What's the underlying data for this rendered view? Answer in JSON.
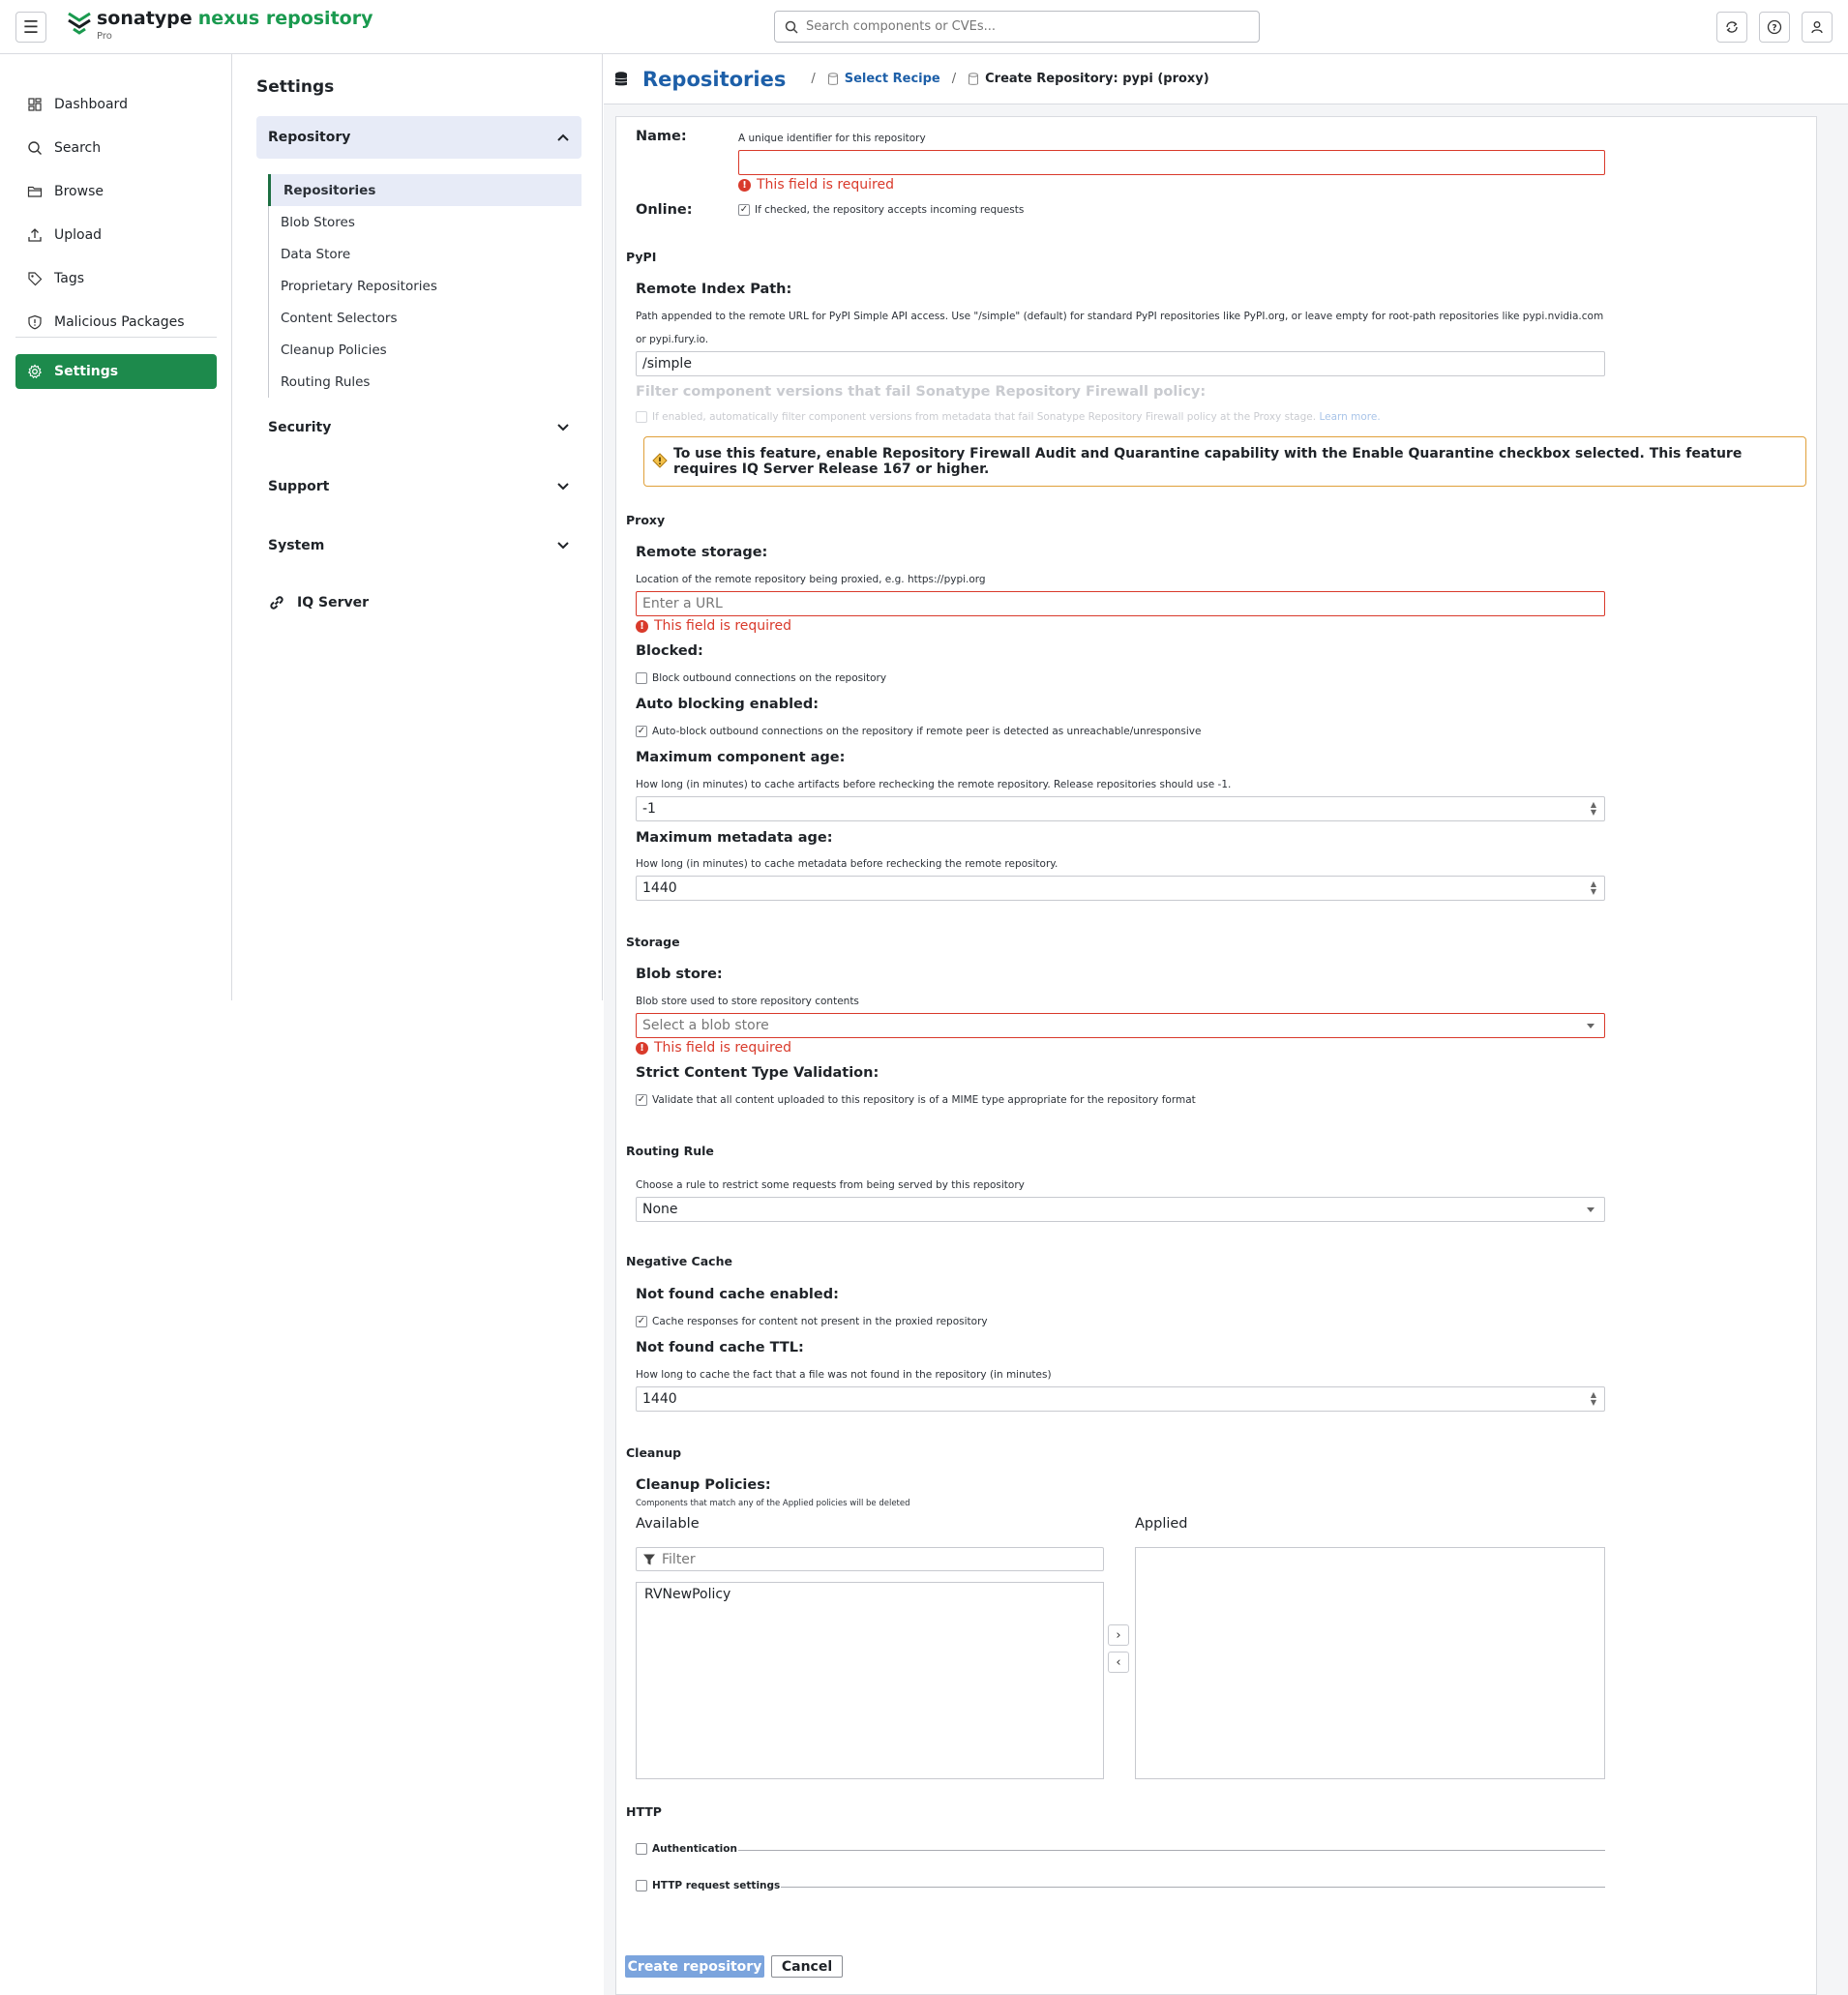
{
  "header": {
    "logo_brand": "sonatype",
    "logo_product": "nexus repository",
    "logo_edition": "Pro",
    "search_placeholder": "Search components or CVEs...",
    "icons": [
      "menu-icon",
      "refresh-icon",
      "help-icon",
      "user-icon"
    ]
  },
  "leftnav": {
    "items": [
      {
        "label": "Dashboard",
        "icon": "dashboard-icon"
      },
      {
        "label": "Search",
        "icon": "search-icon"
      },
      {
        "label": "Browse",
        "icon": "folder-icon"
      },
      {
        "label": "Upload",
        "icon": "upload-icon"
      },
      {
        "label": "Tags",
        "icon": "tag-icon"
      },
      {
        "label": "Malicious Packages",
        "icon": "shield-icon"
      }
    ],
    "settings_label": "Settings"
  },
  "settings": {
    "title": "Settings",
    "repository": "Repository",
    "repo_items": [
      "Repositories",
      "Blob Stores",
      "Data Store",
      "Proprietary Repositories",
      "Content Selectors",
      "Cleanup Policies",
      "Routing Rules"
    ],
    "security": "Security",
    "support": "Support",
    "system": "System",
    "iq_server": "IQ Server"
  },
  "breadcrumb": {
    "root": "Repositories",
    "sep1": "/",
    "select_recipe": "Select Recipe",
    "sep2": "/",
    "current": "Create Repository: pypi (proxy)"
  },
  "form": {
    "required_msg": "This field is required",
    "name": {
      "label": "Name:",
      "hint": "A unique identifier for this repository",
      "value": ""
    },
    "online": {
      "label": "Online:",
      "hint": "If checked, the repository accepts incoming requests",
      "checked": true
    },
    "pypi": {
      "section": "PyPI",
      "remote_index_label": "Remote Index Path:",
      "remote_index_hint1": "Path appended to the remote URL for PyPI Simple API access. Use \"/simple\" (default) for standard PyPI repositories like PyPI.org, or leave empty for root-path repositories like pypi.nvidia.com",
      "remote_index_hint2": "or pypi.fury.io.",
      "remote_index_value": "/simple",
      "firewall_label": "Filter component versions that fail Sonatype Repository Firewall policy:",
      "firewall_hint": "If enabled, automatically filter component versions from metadata that fail Sonatype Repository Firewall policy at the Proxy stage.",
      "firewall_learn": "Learn more.",
      "warning": "To use this feature, enable Repository Firewall Audit and Quarantine capability with the Enable Quarantine checkbox selected. This feature requires IQ Server Release 167 or higher."
    },
    "proxy": {
      "section": "Proxy",
      "remote_label": "Remote storage:",
      "remote_hint": "Location of the remote repository being proxied, e.g. https://pypi.org",
      "remote_placeholder": "Enter a URL",
      "blocked_label": "Blocked:",
      "blocked_hint": "Block outbound connections on the repository",
      "blocked_checked": false,
      "auto_label": "Auto blocking enabled:",
      "auto_hint": "Auto-block outbound connections on the repository if remote peer is detected as unreachable/unresponsive",
      "auto_checked": true,
      "max_comp_label": "Maximum component age:",
      "max_comp_hint": "How long (in minutes) to cache artifacts before rechecking the remote repository. Release repositories should use -1.",
      "max_comp_value": "-1",
      "max_meta_label": "Maximum metadata age:",
      "max_meta_hint": "How long (in minutes) to cache metadata before rechecking the remote repository.",
      "max_meta_value": "1440"
    },
    "storage": {
      "section": "Storage",
      "blob_label": "Blob store:",
      "blob_hint": "Blob store used to store repository contents",
      "blob_placeholder": "Select a blob store",
      "strict_label": "Strict Content Type Validation:",
      "strict_hint": "Validate that all content uploaded to this repository is of a MIME type appropriate for the repository format",
      "strict_checked": true
    },
    "routing": {
      "section": "Routing Rule",
      "hint": "Choose a rule to restrict some requests from being served by this repository",
      "value": "None"
    },
    "negative": {
      "section": "Negative Cache",
      "nf_label": "Not found cache enabled:",
      "nf_hint": "Cache responses for content not present in the proxied repository",
      "nf_checked": true,
      "ttl_label": "Not found cache TTL:",
      "ttl_hint": "How long to cache the fact that a file was not found in the repository (in minutes)",
      "ttl_value": "1440"
    },
    "cleanup": {
      "section": "Cleanup",
      "label": "Cleanup Policies:",
      "hint": "Components that match any of the Applied policies will be deleted",
      "available": "Available",
      "applied": "Applied",
      "filter_placeholder": "Filter",
      "available_items": [
        "RVNewPolicy"
      ]
    },
    "http": {
      "section": "HTTP",
      "auth": "Authentication",
      "request": "HTTP request settings"
    },
    "create_btn": "Create repository",
    "cancel_btn": "Cancel"
  }
}
